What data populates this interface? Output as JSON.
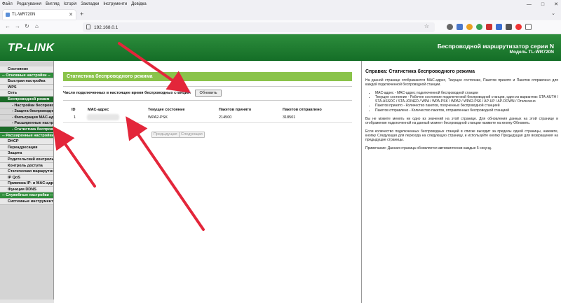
{
  "browser": {
    "menu": [
      "Файл",
      "Редагування",
      "Вигляд",
      "Історія",
      "Закладки",
      "Інструменти",
      "Довідка"
    ],
    "tab_title": "TL-WR720N",
    "url": "192.168.0.1"
  },
  "header": {
    "logo": "TP-LINK",
    "title": "Беспроводной маршрутизатор серии N",
    "model": "Модель TL-WR720N"
  },
  "sidebar": {
    "items": [
      {
        "label": "Состояние",
        "kind": "item"
      },
      {
        "label": "-- Основные настройки --",
        "kind": "section"
      },
      {
        "label": "Быстрая настройка",
        "kind": "item"
      },
      {
        "label": "WPS",
        "kind": "item"
      },
      {
        "label": "Сеть",
        "kind": "item"
      },
      {
        "label": "Беспроводной режим",
        "kind": "active"
      },
      {
        "label": "- Настройки беспроводного",
        "kind": "sub"
      },
      {
        "label": "- Защита беспроводного р",
        "kind": "sub"
      },
      {
        "label": "- Фильтрация MAC-адре",
        "kind": "sub"
      },
      {
        "label": "- Расширенные настрой",
        "kind": "sub"
      },
      {
        "label": "- Статистика беспровод",
        "kind": "active-sub"
      },
      {
        "label": "-- Расширенные настройки --",
        "kind": "section"
      },
      {
        "label": "DHCP",
        "kind": "item"
      },
      {
        "label": "Переадресация",
        "kind": "item"
      },
      {
        "label": "Защита",
        "kind": "item"
      },
      {
        "label": "Родительский контроль",
        "kind": "item"
      },
      {
        "label": "Контроль доступа",
        "kind": "item"
      },
      {
        "label": "Статическая маршрутизац",
        "kind": "item"
      },
      {
        "label": "IP QoS",
        "kind": "item"
      },
      {
        "label": "Привязка IP- и MAC-адрес",
        "kind": "item"
      },
      {
        "label": "Функция DDNS",
        "kind": "item"
      },
      {
        "label": "-- Служебные настройки --",
        "kind": "section"
      },
      {
        "label": "Системные инструменты",
        "kind": "item"
      }
    ]
  },
  "main": {
    "panel_title": "Статистика беспроводного режима",
    "stations_label": "Число подключенных в настоящее время беспроводных станций:",
    "stations_count": "1",
    "refresh_button": "Обновить",
    "table": {
      "headers": [
        "ID",
        "MAC-адрес",
        "Текущее состояние",
        "Пакетов принято",
        "Пакетов отправлено"
      ],
      "rows": [
        {
          "id": "1",
          "mac": "",
          "state": "WPA2-PSK",
          "received": "214500",
          "sent": "318501"
        }
      ]
    },
    "prev_button": "Предыдущая",
    "next_button": "Следующая"
  },
  "help": {
    "title": "Справка: Статистика беспроводного режима",
    "intro": "На данной странице отображаются MAC-адрес, Текущее состояние, Пакетов принято и Пакетов отправлено для каждой подключенной беспроводной станции.",
    "bullets": [
      "MAC-адрес - MAC-адрес подключенной беспроводной станции",
      "Текущее состояние - Рабочее состояние подключенной беспроводной станции, один из вариантов: STA-AUTH / STA-ASSOC / STA-JOINED / WPA / WPA-PSK / WPA2 / WPA2-PSK / AP-UP / AP-DOWN / Отключено",
      "Пакетов принято - Количество пакетов, полученных беспроводной станцией",
      "Пакетов отправлено - Количество пакетов, отправленных беспроводной станцией"
    ],
    "para2": "Вы не можете менять ни одно из значений на этой странице. Для обновления данных на этой странице и отображения подключенной на данный момент беспроводной станции нажмите на кнопку Обновить.",
    "para3": "Если количество подключенных беспроводных станций в списке выходит за пределы одной страницы, нажмите, кнопку Следующая для перехода на следующую страницу, и используйте кнопку Предыдущая для возвращения на предыдущие страницы.",
    "note": "Примечание: Данная страница обновляется автоматически каждые 5 секунд."
  },
  "colors": {
    "header_green": "#146e27",
    "sidebar_section": "#2f8d3b",
    "panel_title": "#8ac34a",
    "arrow_red": "#e3263a"
  }
}
